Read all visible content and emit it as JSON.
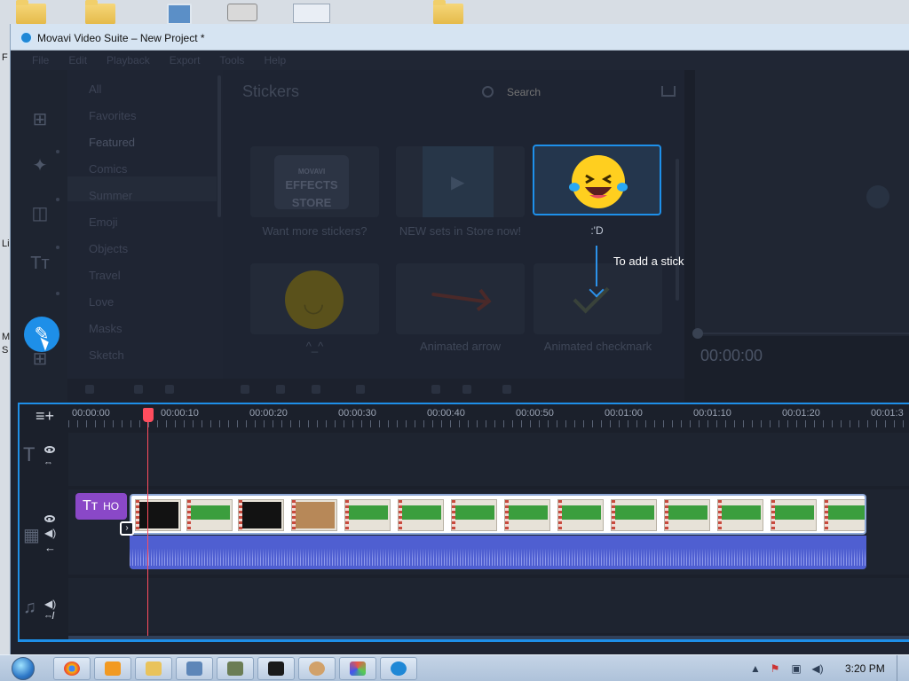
{
  "window": {
    "title": "Movavi Video Suite – New Project *"
  },
  "menu": {
    "items": [
      "File",
      "Edit",
      "Playback",
      "Export",
      "Tools",
      "Help"
    ]
  },
  "categories": [
    {
      "label": "All"
    },
    {
      "label": "Favorites"
    },
    {
      "label": "Featured"
    },
    {
      "label": "Comics"
    },
    {
      "label": "Summer"
    },
    {
      "label": "Emoji"
    },
    {
      "label": "Objects"
    },
    {
      "label": "Travel"
    },
    {
      "label": "Love"
    },
    {
      "label": "Masks"
    },
    {
      "label": "Sketch"
    }
  ],
  "stickers": {
    "title": "Stickers",
    "search_placeholder": "Search",
    "items": [
      {
        "label": "Want more stickers?",
        "logo": "EFFECTS STORE",
        "logo_top": "MOVAVI"
      },
      {
        "label": "NEW sets in Store now!"
      },
      {
        "label": ":'D"
      },
      {
        "label": "^_^"
      },
      {
        "label": "Animated arrow"
      },
      {
        "label": "Animated checkmark"
      }
    ],
    "tooltip": "To add a sticker, drag it onto the title track"
  },
  "preview": {
    "time": "00:00:00"
  },
  "timeline": {
    "ruler": [
      "00:00:00",
      "00:00:10",
      "00:00:20",
      "00:00:30",
      "00:00:40",
      "00:00:50",
      "00:01:00",
      "00:01:10",
      "00:01:20",
      "00:01:3"
    ],
    "title_clip": "HO"
  },
  "taskbar": {
    "clock": "3:20 PM"
  },
  "desktop_labels": [
    "F",
    "Li",
    "M",
    "S"
  ],
  "colors": {
    "accent": "#1e8fe8",
    "title_clip": "#8a48c7",
    "audio": "#4f5fd1",
    "playhead": "#ff4d5e"
  }
}
